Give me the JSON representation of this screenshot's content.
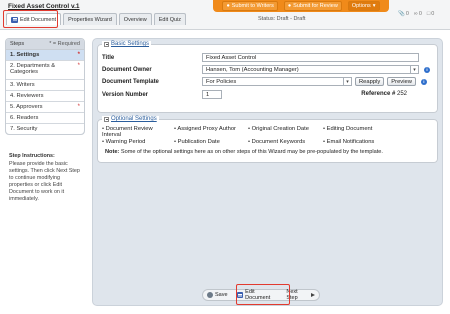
{
  "header": {
    "doc_title": "Fixed Asset Control v.1",
    "status": "Status: Draft - Draft"
  },
  "top_actions": {
    "submit_writers": "Submit to Writers",
    "submit_review": "Submit for Review",
    "options": "Options"
  },
  "counters": {
    "attachments": "0",
    "links": "0",
    "comments": "0"
  },
  "tabs": [
    "Edit Document",
    "Properties Wizard",
    "Overview",
    "Edit Quiz"
  ],
  "steps": {
    "title": "Steps",
    "required_note": "* = Required",
    "items": [
      {
        "label": "1. Settings",
        "required": true
      },
      {
        "label": "2. Departments & Categories",
        "required": true
      },
      {
        "label": "3. Writers",
        "required": false
      },
      {
        "label": "4. Reviewers",
        "required": false
      },
      {
        "label": "5. Approvers",
        "required": true
      },
      {
        "label": "6. Readers",
        "required": false
      },
      {
        "label": "7. Security",
        "required": false
      }
    ],
    "star": "*"
  },
  "instructions": {
    "title": "Step Instructions:",
    "text": "Please provide the basic settings. Then click Next Step to continue modifying properties or click Edit Document to work on it immediately."
  },
  "basic": {
    "legend": "Basic Settings",
    "title_label": "Title",
    "title_value": "Fixed Asset Control",
    "owner_label": "Document Owner",
    "owner_value": "Hansen, Tom (Accounting Manager)",
    "template_label": "Document Template",
    "template_value": "For Policies",
    "reapply": "Reapply",
    "preview": "Preview",
    "version_label": "Version Number",
    "version_value": "1",
    "reference_label": "Reference #",
    "reference_value": "252"
  },
  "optional": {
    "legend": "Optional Settings",
    "items": [
      "Document Review Interval",
      "Assigned Proxy Author",
      "Original Creation Date",
      "Editing Document",
      "Warning Period",
      "Publication Date",
      "Document Keywords",
      "Email Notifications"
    ],
    "note_bold": "Note:",
    "note": " Some of the optional settings here as on other steps of this Wizard may be pre-populated by the template."
  },
  "actions": {
    "save": "Save",
    "edit_document": "Edit Document",
    "next_step": "Next Step"
  },
  "icons": {
    "info": "info-icon",
    "save": "save-icon",
    "next": "play-icon"
  },
  "colors": {
    "accent_orange": "#f08a1a",
    "highlight_red": "#e23a2f",
    "link_blue": "#2a5d9c"
  }
}
